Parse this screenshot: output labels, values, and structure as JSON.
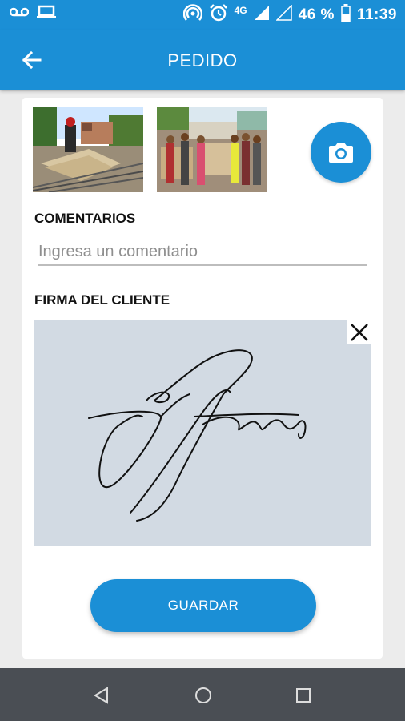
{
  "status_bar": {
    "network": "4G",
    "battery": "46 %",
    "time": "11:39",
    "icons": [
      "voicemail-icon",
      "laptop-icon",
      "hotspot-icon",
      "alarm-icon",
      "signal-icon",
      "signal-empty-icon",
      "battery-icon"
    ]
  },
  "app_bar": {
    "title": "PEDIDO",
    "back_icon": "arrow-back-icon"
  },
  "photos": {
    "items": [
      "photo-1",
      "photo-2"
    ],
    "camera_icon": "camera-icon"
  },
  "comments": {
    "label": "COMENTARIOS",
    "value": "",
    "placeholder": "Ingresa un comentario"
  },
  "signature": {
    "label": "FIRMA DEL CLIENTE",
    "clear_icon": "close-icon"
  },
  "actions": {
    "save_label": "GUARDAR"
  },
  "colors": {
    "primary": "#1b8fd6",
    "signature_bg": "#d2dae3",
    "nav_bar": "#4a4e54"
  },
  "nav_bar": {
    "icons": [
      "nav-back-icon",
      "nav-home-icon",
      "nav-recents-icon"
    ]
  }
}
